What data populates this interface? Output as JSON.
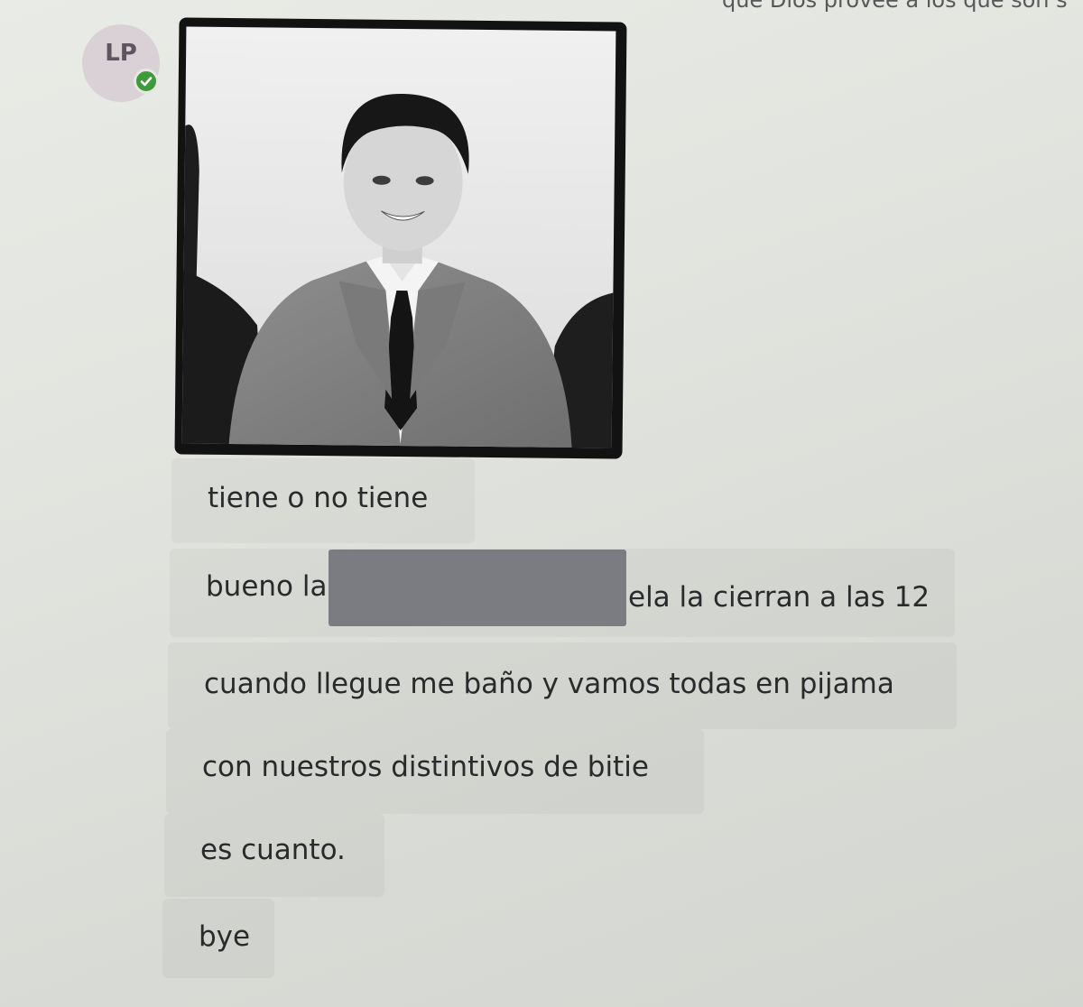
{
  "header": {
    "partial_message": "que Dios provee a los que son s"
  },
  "sender": {
    "initials": "LP",
    "status": "available",
    "avatar_color": "#d9d1d5",
    "status_color": "#3f9a3a"
  },
  "messages": [
    {
      "text": "tiene o no tiene"
    },
    {
      "text_before": "bueno la",
      "text_after": "ela la cierran a las 12",
      "redacted": true
    },
    {
      "text": "cuando llegue me baño y vamos todas en pijama"
    },
    {
      "text": "con nuestros distintivos de bitie"
    },
    {
      "text": "es cuanto."
    },
    {
      "text": "bye"
    }
  ],
  "colors": {
    "message_text": "#2a2a2c",
    "redaction": "#7b7b82",
    "image_frame": "#121212"
  }
}
